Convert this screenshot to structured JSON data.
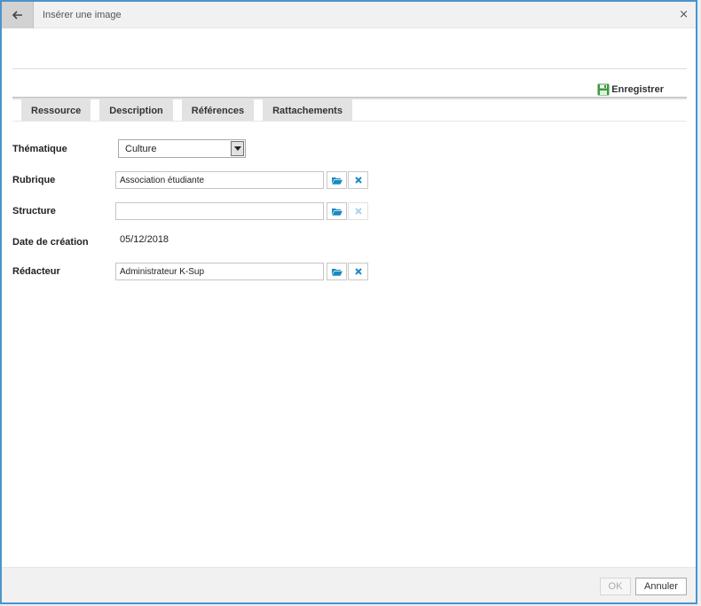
{
  "dialog": {
    "title": "Insérer une image",
    "close_symbol": "×"
  },
  "toolbar": {
    "save_label": "Enregistrer"
  },
  "tabs": [
    {
      "label": "Ressource"
    },
    {
      "label": "Description"
    },
    {
      "label": "Références"
    },
    {
      "label": "Rattachements"
    }
  ],
  "form": {
    "thematique": {
      "label": "Thématique",
      "value": "Culture"
    },
    "rubrique": {
      "label": "Rubrique",
      "value": "Association étudiante"
    },
    "structure": {
      "label": "Structure",
      "value": ""
    },
    "date_creation": {
      "label": "Date de création",
      "value": "05/12/2018"
    },
    "redacteur": {
      "label": "Rédacteur",
      "value": "Administrateur K-Sup"
    }
  },
  "footer": {
    "ok_label": "OK",
    "cancel_label": "Annuler"
  },
  "icons": {
    "back": "arrow-left-icon",
    "save": "floppy-disk-icon",
    "browse": "folder-open-icon",
    "clear": "x-icon"
  },
  "colors": {
    "accent_border": "#4d93c9",
    "save_icon": "#3e9a3e",
    "icon_blue": "#1a8ac0"
  }
}
